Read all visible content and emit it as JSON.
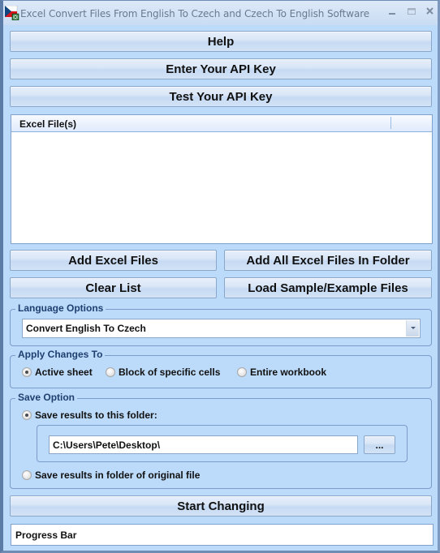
{
  "window": {
    "title": "Excel Convert Files From English To Czech and Czech To English Software",
    "icon": "czech-flag-excel-icon",
    "controls": {
      "minimize": "minimize-icon",
      "maximize": "maximize-icon",
      "close": "close-icon"
    }
  },
  "top_buttons": {
    "help": "Help",
    "enter_api_key": "Enter Your API Key",
    "test_api_key": "Test Your API Key"
  },
  "file_list": {
    "column_header": "Excel File(s)",
    "items": []
  },
  "file_buttons": {
    "add_files": "Add Excel Files",
    "add_folder": "Add All Excel Files In Folder",
    "clear_list": "Clear List",
    "load_samples": "Load Sample/Example Files"
  },
  "language_options": {
    "legend": "Language Options",
    "selected": "Convert English To Czech"
  },
  "apply_changes": {
    "legend": "Apply Changes To",
    "options": [
      {
        "label": "Active sheet",
        "checked": true
      },
      {
        "label": "Block of specific cells",
        "checked": false
      },
      {
        "label": "Entire workbook",
        "checked": false
      }
    ]
  },
  "save_option": {
    "legend": "Save Option",
    "save_to_folder_label": "Save results to this folder:",
    "save_to_folder_checked": true,
    "folder_path": "C:\\Users\\Pete\\Desktop\\",
    "browse_label": "...",
    "save_in_original_label": "Save results in folder of original file",
    "save_in_original_checked": false
  },
  "start_button": "Start Changing",
  "progress": {
    "label": "Progress Bar"
  },
  "colors": {
    "window_bg": "#bcdaf9",
    "group_legend_text": "#1f3f70",
    "border": "#7a9ccb"
  }
}
